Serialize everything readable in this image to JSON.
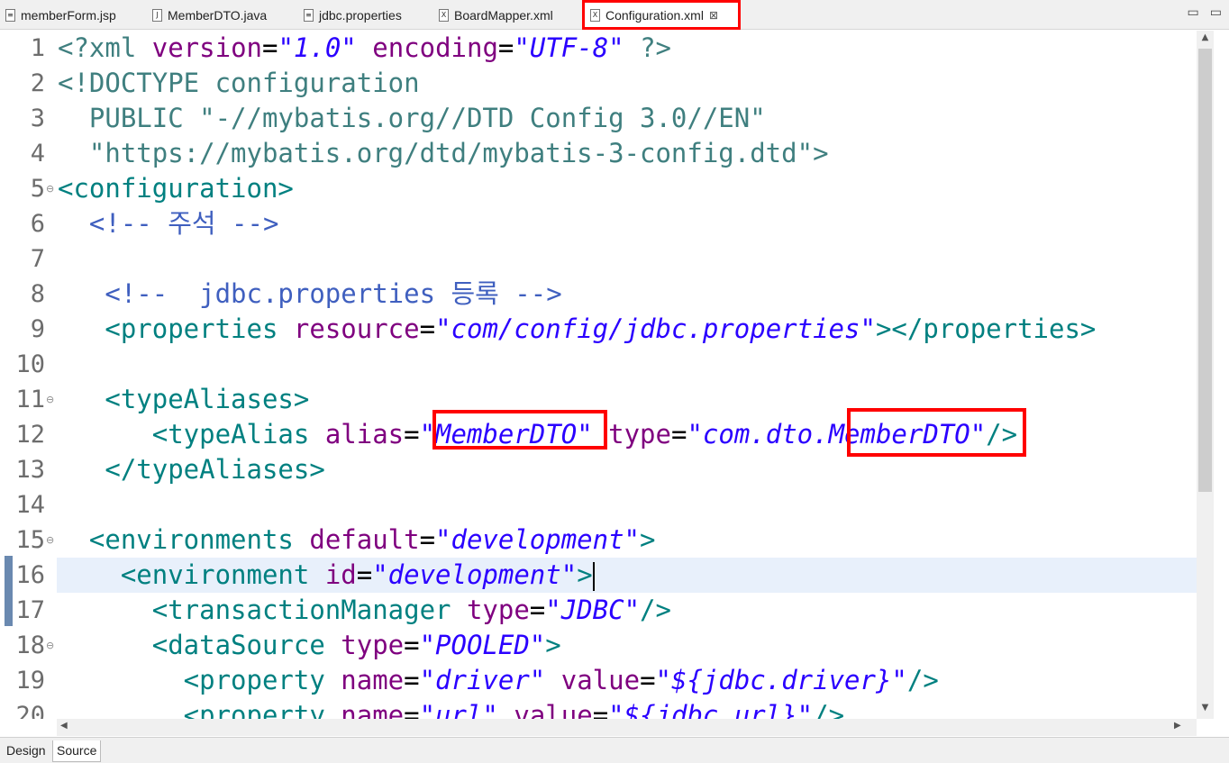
{
  "tabs": [
    {
      "label": "memberForm.jsp",
      "icon": "jsp-file-icon",
      "active": false
    },
    {
      "label": "MemberDTO.java",
      "icon": "java-file-icon",
      "active": false
    },
    {
      "label": "jdbc.properties",
      "icon": "properties-file-icon",
      "active": false
    },
    {
      "label": "BoardMapper.xml",
      "icon": "xml-file-icon",
      "active": false
    },
    {
      "label": "Configuration.xml",
      "icon": "xml-file-icon",
      "active": true,
      "close": "⊠"
    }
  ],
  "window_buttons": [
    "▭",
    "▭"
  ],
  "editor": {
    "current_line": 16,
    "lines": [
      {
        "n": "1",
        "fold": "",
        "tokens": [
          [
            "pi",
            "<?xml "
          ],
          [
            "an",
            "version"
          ],
          [
            "eq",
            "="
          ],
          [
            "av",
            "\"1.0\""
          ],
          [
            "pi",
            " "
          ],
          [
            "an",
            "encoding"
          ],
          [
            "eq",
            "="
          ],
          [
            "av",
            "\"UTF-8\""
          ],
          [
            "pi",
            " ?>"
          ]
        ]
      },
      {
        "n": "2",
        "fold": "",
        "tokens": [
          [
            "pi",
            "<!DOCTYPE configuration"
          ]
        ]
      },
      {
        "n": "3",
        "fold": "",
        "tokens": [
          [
            "tx",
            "  PUBLIC "
          ],
          [
            "tx",
            "\"-//mybatis.org//DTD Config 3.0//EN\""
          ]
        ]
      },
      {
        "n": "4",
        "fold": "",
        "tokens": [
          [
            "tx",
            "  \"https://mybatis.org/dtd/mybatis-3-config.dtd\""
          ],
          [
            "pi",
            ">"
          ]
        ]
      },
      {
        "n": "5",
        "fold": "⊖",
        "tokens": [
          [
            "tg",
            "<configuration>"
          ]
        ]
      },
      {
        "n": "6",
        "fold": "",
        "tokens": [
          [
            "cm",
            "  <!-- 주석 -->"
          ]
        ]
      },
      {
        "n": "7",
        "fold": "",
        "tokens": []
      },
      {
        "n": "8",
        "fold": "",
        "tokens": [
          [
            "cm",
            "   <!--  jdbc.properties 등록 -->"
          ]
        ]
      },
      {
        "n": "9",
        "fold": "",
        "tokens": [
          [
            "tg",
            "   <properties "
          ],
          [
            "an",
            "resource"
          ],
          [
            "eq",
            "="
          ],
          [
            "av",
            "\"com/config/jdbc.properties\""
          ],
          [
            "tg",
            "></properties>"
          ]
        ]
      },
      {
        "n": "10",
        "fold": "",
        "tokens": []
      },
      {
        "n": "11",
        "fold": "⊖",
        "tokens": [
          [
            "tg",
            "   <typeAliases>"
          ]
        ]
      },
      {
        "n": "12",
        "fold": "",
        "tokens": [
          [
            "tg",
            "      <typeAlias "
          ],
          [
            "an",
            "alias"
          ],
          [
            "eq",
            "="
          ],
          [
            "av",
            "\"MemberDTO\""
          ],
          [
            "tg",
            " "
          ],
          [
            "an",
            "type"
          ],
          [
            "eq",
            "="
          ],
          [
            "av",
            "\"com.dto.MemberDTO\""
          ],
          [
            "tg",
            "/>"
          ]
        ]
      },
      {
        "n": "13",
        "fold": "",
        "tokens": [
          [
            "tg",
            "   </typeAliases>"
          ]
        ]
      },
      {
        "n": "14",
        "fold": "",
        "tokens": []
      },
      {
        "n": "15",
        "fold": "⊖",
        "tokens": [
          [
            "tg",
            "  <environments "
          ],
          [
            "an",
            "default"
          ],
          [
            "eq",
            "="
          ],
          [
            "av",
            "\"development\""
          ],
          [
            "tg",
            ">"
          ]
        ]
      },
      {
        "n": "16",
        "fold": "",
        "tokens": [
          [
            "tg",
            "    <environment "
          ],
          [
            "an",
            "id"
          ],
          [
            "eq",
            "="
          ],
          [
            "av",
            "\"development\""
          ],
          [
            "tg",
            ">"
          ],
          [
            "cursor",
            ""
          ]
        ]
      },
      {
        "n": "17",
        "fold": "",
        "tokens": [
          [
            "tg",
            "      <transactionManager "
          ],
          [
            "an",
            "type"
          ],
          [
            "eq",
            "="
          ],
          [
            "av",
            "\"JDBC\""
          ],
          [
            "tg",
            "/>"
          ]
        ]
      },
      {
        "n": "18",
        "fold": "⊖",
        "tokens": [
          [
            "tg",
            "      <dataSource "
          ],
          [
            "an",
            "type"
          ],
          [
            "eq",
            "="
          ],
          [
            "av",
            "\"POOLED\""
          ],
          [
            "tg",
            ">"
          ]
        ]
      },
      {
        "n": "19",
        "fold": "",
        "tokens": [
          [
            "tg",
            "        <property "
          ],
          [
            "an",
            "name"
          ],
          [
            "eq",
            "="
          ],
          [
            "av",
            "\"driver\""
          ],
          [
            "tg",
            " "
          ],
          [
            "an",
            "value"
          ],
          [
            "eq",
            "="
          ],
          [
            "av",
            "\"${jdbc.driver}\""
          ],
          [
            "tg",
            "/>"
          ]
        ]
      },
      {
        "n": "20",
        "fold": "",
        "tokens": [
          [
            "tg",
            "        <property "
          ],
          [
            "an",
            "name"
          ],
          [
            "eq",
            "="
          ],
          [
            "av",
            "\"url\""
          ],
          [
            "tg",
            " "
          ],
          [
            "an",
            "value"
          ],
          [
            "eq",
            "="
          ],
          [
            "av",
            "\"${jdbc.url}\""
          ],
          [
            "tg",
            "/>"
          ]
        ]
      }
    ]
  },
  "scroll": {
    "up": "▲",
    "down": "▼",
    "left": "◀",
    "right": "▶"
  },
  "bottom_tabs": [
    {
      "label": "Design",
      "active": false
    },
    {
      "label": "Source",
      "active": true
    }
  ],
  "colors": {
    "highlight": "#ff0000",
    "tag": "#008080",
    "attr_name": "#7f007f",
    "attr_value": "#2a00ff",
    "comment": "#3f5fbf"
  }
}
